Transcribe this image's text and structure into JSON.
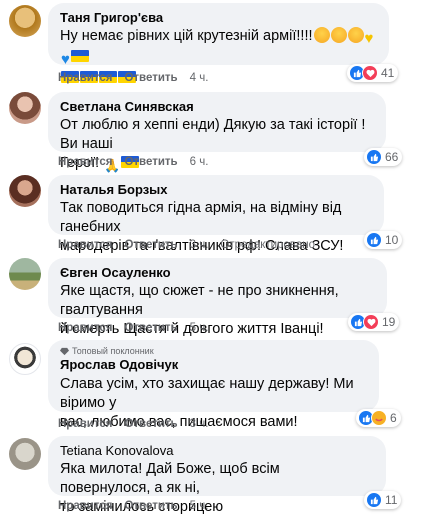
{
  "comments": [
    {
      "author": "Таня Григор'єва",
      "text": "Ну немає рівних цій крутезній армії!!!!",
      "like_label": "Нравится",
      "reply_label": "Ответить",
      "time": "4 ч.",
      "reactions": [
        "like",
        "love"
      ],
      "reaction_count": "41"
    },
    {
      "author": "Светлана Синявская",
      "text1": "От люблю я хеппі енди) Дякую за такі історії ! Ви наші",
      "text2": "Герої!",
      "like_label": "Нравится",
      "reply_label": "Ответить",
      "time": "6 ч.",
      "reactions": [
        "like"
      ],
      "reaction_count": "66"
    },
    {
      "author": "Наталья Борзых",
      "text1": "Так поводиться гідна армія, на відміну від ганебних",
      "text2": "мародерів та ґвалтівників рф! Слава ЗСУ!",
      "like_label": "Нравится",
      "reply_label": "Ответить",
      "time": "3 ч.",
      "edited": "Отредактировано",
      "reactions": [
        "like"
      ],
      "reaction_count": "10"
    },
    {
      "author": "Євген Осауленко",
      "text1": "Яке щастя, що сюжет - не про зникнення, гвалтування",
      "text2": "й смерть Щастя й довгого життя Іванці!",
      "like_label": "Нравится",
      "reply_label": "Ответить",
      "time": "5 ч.",
      "reactions": [
        "like",
        "love"
      ],
      "reaction_count": "19"
    },
    {
      "badge": "Топовый поклонник",
      "author": "Ярослав Одовічук",
      "text1": "Слава усім, хто захищає нашу державу! Ми віримо у",
      "text2": "вас, любимо вас, пишаємося вами!",
      "like_label": "Нравится",
      "reply_label": "Ответить",
      "time": "3 ч.",
      "reactions": [
        "like",
        "care"
      ],
      "reaction_count": "6"
    },
    {
      "author": "Tetiana Konovalova",
      "text1": "Яка милота! Дай Боже, щоб всім повернулося, а як ні,",
      "text2": "то замінилось сторицею",
      "like_label": "Нравится",
      "reply_label": "Ответить",
      "time": "5 ч.",
      "reactions": [
        "like"
      ],
      "reaction_count": "11"
    }
  ],
  "colors": {
    "like": "#1877f2",
    "love": "#f33e58",
    "care": "#f7b125",
    "bubble": "#f0f2f5"
  }
}
